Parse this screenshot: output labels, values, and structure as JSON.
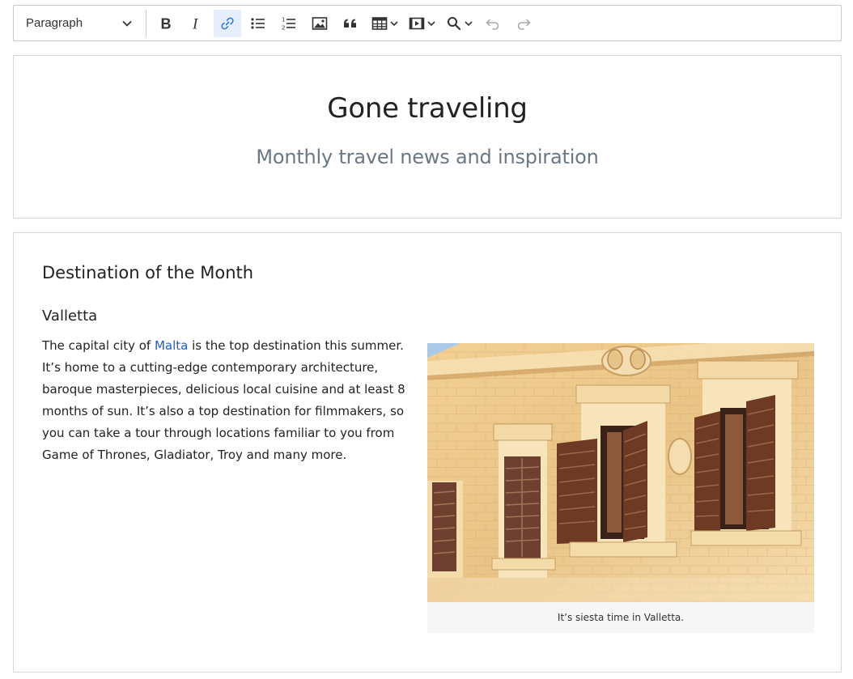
{
  "toolbar": {
    "heading_select": {
      "value": "Paragraph"
    },
    "buttons": [
      {
        "name": "bold",
        "icon": "bold-icon"
      },
      {
        "name": "italic",
        "icon": "italic-icon"
      },
      {
        "name": "link",
        "icon": "link-icon",
        "active": true
      },
      {
        "name": "bulleted-list",
        "icon": "bulleted-list-icon"
      },
      {
        "name": "numbered-list",
        "icon": "numbered-list-icon"
      },
      {
        "name": "insert-image",
        "icon": "image-icon"
      },
      {
        "name": "block-quote",
        "icon": "quote-icon"
      },
      {
        "name": "insert-table",
        "icon": "table-icon"
      },
      {
        "name": "insert-media",
        "icon": "media-icon"
      },
      {
        "name": "find-replace",
        "icon": "find-replace-icon"
      },
      {
        "name": "undo",
        "icon": "undo-icon"
      },
      {
        "name": "redo",
        "icon": "redo-icon"
      }
    ],
    "active_color": "#2d7be5"
  },
  "header": {
    "title": "Gone traveling",
    "subtitle": "Monthly travel news and inspiration"
  },
  "article": {
    "section_title": "Destination of the Month",
    "city_title": "Valletta",
    "body_before_link": "The capital city of ",
    "link_text": "Malta",
    "body_after_link": " is the top destination this summer. It’s home to a cutting-edge contemporary architecture, baroque masterpieces, delicious local cuisine and at least 8 months of sun. It’s also a top destination for filmmakers, so you can take a tour through locations familiar to you from Game of Thrones, Gladiator, Troy and many more.",
    "link_color": "#1a5bd6",
    "figure": {
      "caption": "It’s siesta time in Valletta."
    }
  }
}
